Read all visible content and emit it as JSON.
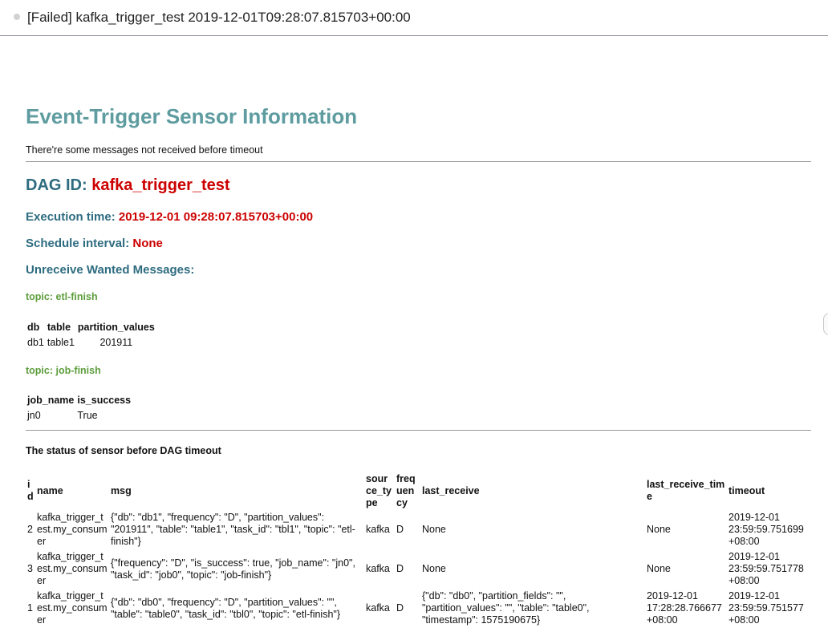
{
  "email": {
    "subject": "[Failed] kafka_trigger_test 2019-12-01T09:28:07.815703+00:00"
  },
  "report": {
    "title": "Event-Trigger Sensor Information",
    "note": "There're some messages not received before timeout",
    "dag_id_label": "DAG ID:",
    "dag_id_value": "kafka_trigger_test",
    "execution_time_label": "Execution time:",
    "execution_time_value": "2019-12-01 09:28:07.815703+00:00",
    "schedule_interval_label": "Schedule interval:",
    "schedule_interval_value": "None",
    "unreceived_heading": "Unreceive Wanted Messages:"
  },
  "topics": [
    {
      "label": "topic: etl-finish",
      "columns": [
        "db",
        "table",
        "partition_values"
      ],
      "rows": [
        [
          "db1",
          "table1",
          "201911"
        ]
      ]
    },
    {
      "label": "topic: job-finish",
      "columns": [
        "job_name",
        "is_success"
      ],
      "rows": [
        [
          "jn0",
          "True"
        ]
      ]
    }
  ],
  "status": {
    "heading": "The status of sensor before DAG timeout",
    "columns": [
      "id",
      "name",
      "msg",
      "source_type",
      "frequency",
      "last_receive",
      "last_receive_time",
      "timeout"
    ],
    "rows": [
      [
        "2",
        "kafka_trigger_test.my_consumer",
        "{\"db\": \"db1\", \"frequency\": \"D\", \"partition_values\": \"201911\", \"table\": \"table1\", \"task_id\": \"tbl1\", \"topic\": \"etl-finish\"}",
        "kafka",
        "D",
        "None",
        "None",
        "2019-12-01 23:59:59.751699 +08:00"
      ],
      [
        "3",
        "kafka_trigger_test.my_consumer",
        "{\"frequency\": \"D\", \"is_success\": true, \"job_name\": \"jn0\", \"task_id\": \"job0\", \"topic\": \"job-finish\"}",
        "kafka",
        "D",
        "None",
        "None",
        "2019-12-01 23:59:59.751778 +08:00"
      ],
      [
        "1",
        "kafka_trigger_test.my_consumer",
        "{\"db\": \"db0\", \"frequency\": \"D\", \"partition_values\": \"\", \"table\": \"table0\", \"task_id\": \"tbl0\", \"topic\": \"etl-finish\"}",
        "kafka",
        "D",
        "{\"db\": \"db0\", \"partition_fields\": \"\", \"partition_values\": \"\", \"table\": \"table0\", \"timestamp\": 1575190675}",
        "2019-12-01 17:28:28.766677 +08:00",
        "2019-12-01 23:59:59.751577 +08:00"
      ]
    ]
  }
}
